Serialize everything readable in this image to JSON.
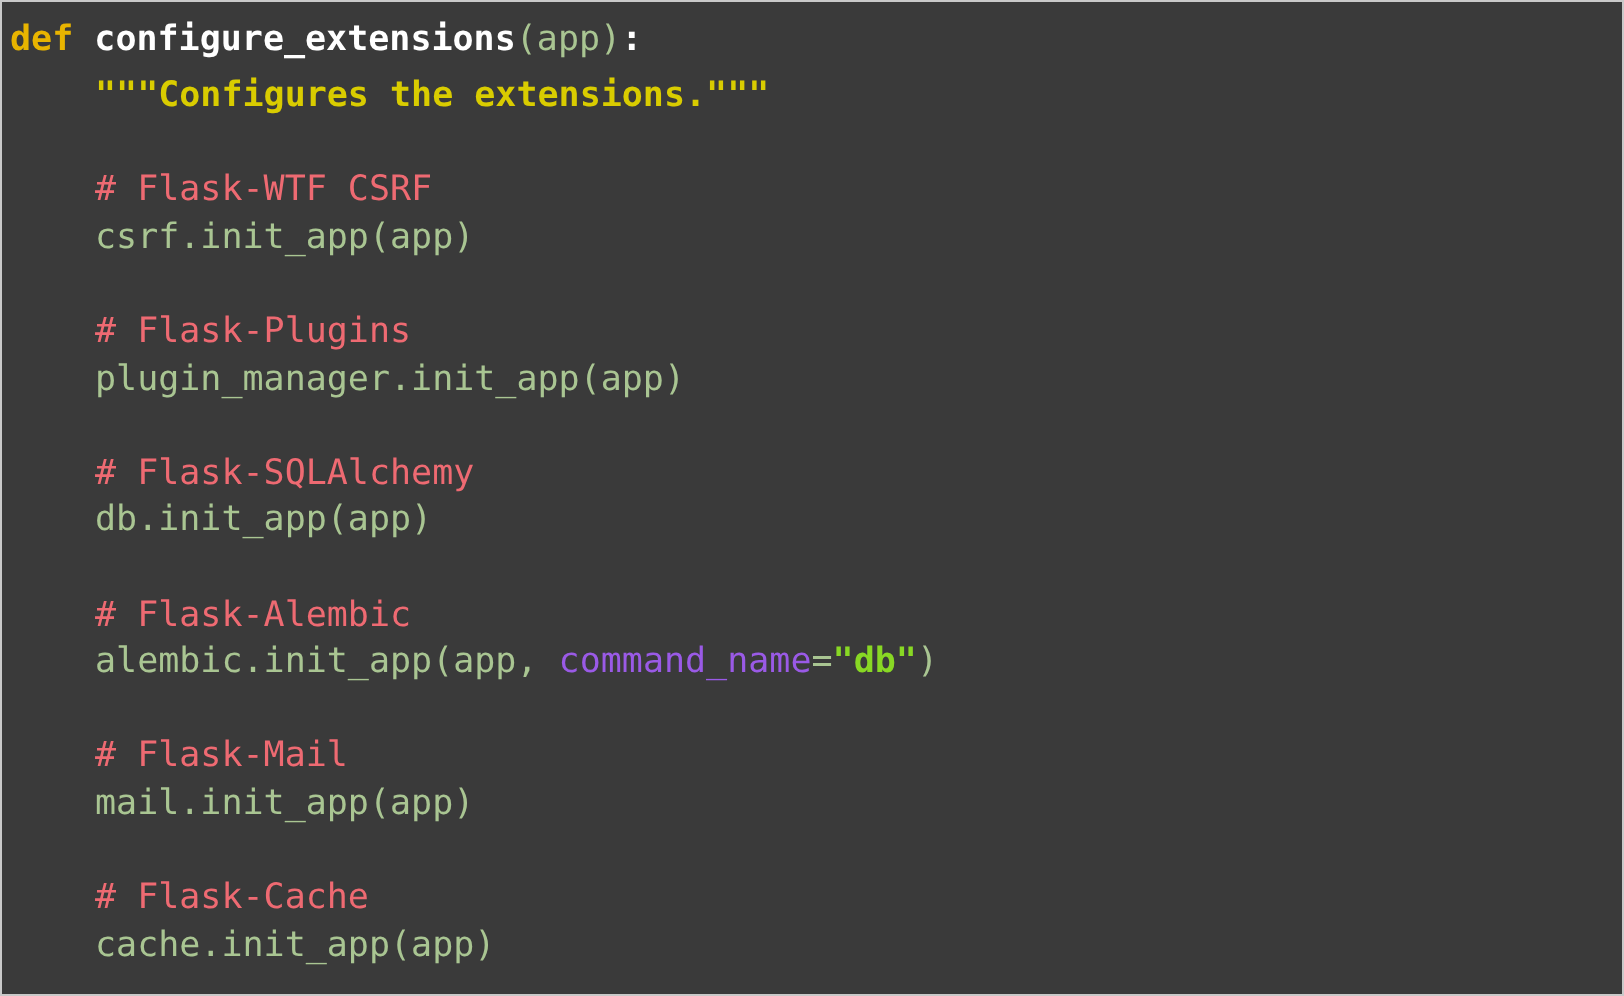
{
  "code": {
    "signature": {
      "tokens": [
        {
          "kind": "keyword",
          "text": "def "
        },
        {
          "kind": "function",
          "text": "configure_extensions"
        },
        {
          "kind": "plain",
          "text": "(app)"
        },
        {
          "kind": "punct",
          "text": ":"
        }
      ]
    },
    "children": [
      {
        "lines": [
          {
            "tokens": [
              {
                "kind": "docstring",
                "text": "\"\"\"Configures the extensions.\"\"\""
              }
            ]
          }
        ]
      },
      {
        "lines": [
          {
            "tokens": [
              {
                "kind": "comment",
                "text": "# Flask-WTF CSRF"
              }
            ]
          },
          {
            "tokens": [
              {
                "kind": "plain",
                "text": "csrf.init_app(app)"
              }
            ]
          }
        ]
      },
      {
        "lines": [
          {
            "tokens": [
              {
                "kind": "comment",
                "text": "# Flask-Plugins"
              }
            ]
          },
          {
            "tokens": [
              {
                "kind": "plain",
                "text": "plugin_manager.init_app(app)"
              }
            ]
          }
        ]
      },
      {
        "lines": [
          {
            "tokens": [
              {
                "kind": "comment",
                "text": "# Flask-SQLAlchemy"
              }
            ]
          },
          {
            "tokens": [
              {
                "kind": "plain",
                "text": "db.init_app(app)"
              }
            ]
          }
        ]
      },
      {
        "lines": [
          {
            "tokens": [
              {
                "kind": "comment",
                "text": "# Flask-Alembic"
              }
            ]
          },
          {
            "tokens": [
              {
                "kind": "plain",
                "text": "alembic.init_app(app, "
              },
              {
                "kind": "param",
                "text": "command_name"
              },
              {
                "kind": "plain",
                "text": "="
              },
              {
                "kind": "string",
                "text": "\"db\""
              },
              {
                "kind": "plain",
                "text": ")"
              }
            ]
          }
        ]
      },
      {
        "lines": [
          {
            "tokens": [
              {
                "kind": "comment",
                "text": "# Flask-Mail"
              }
            ]
          },
          {
            "tokens": [
              {
                "kind": "plain",
                "text": "mail.init_app(app)"
              }
            ]
          }
        ]
      },
      {
        "lines": [
          {
            "tokens": [
              {
                "kind": "comment",
                "text": "# Flask-Cache"
              }
            ]
          },
          {
            "tokens": [
              {
                "kind": "plain",
                "text": "cache.init_app(app)"
              }
            ]
          }
        ]
      }
    ]
  }
}
